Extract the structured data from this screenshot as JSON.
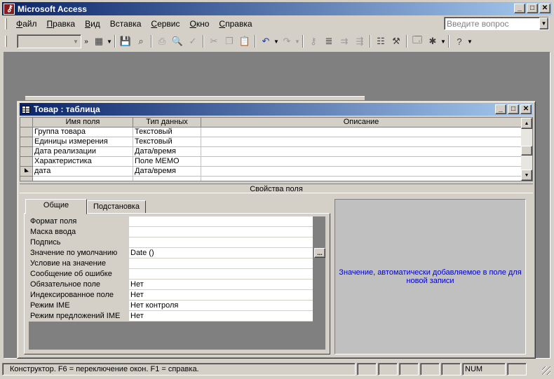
{
  "app": {
    "title": "Microsoft Access",
    "minimize": "_",
    "maximize": "□",
    "close": "✕"
  },
  "menu": {
    "items": [
      {
        "label": "Файл",
        "accel": "Ф",
        "rest": "айл"
      },
      {
        "label": "Правка",
        "accel": "П",
        "rest": "равка"
      },
      {
        "label": "Вид",
        "accel": "В",
        "rest": "ид"
      },
      {
        "label": "Вставка",
        "accel": "",
        "rest": "Вставка"
      },
      {
        "label": "Сервис",
        "accel": "С",
        "rest": "ервис"
      },
      {
        "label": "Окно",
        "accel": "О",
        "rest": "кно"
      },
      {
        "label": "Справка",
        "accel": "С",
        "rest": "правка"
      }
    ],
    "help_placeholder": "Введите вопрос"
  },
  "toolbar": {
    "icons": [
      "view-icon",
      "save-icon",
      "search-icon",
      "print-icon",
      "print-preview-icon",
      "spelling-icon",
      "cut-icon",
      "copy-icon",
      "paste-icon",
      "undo-icon",
      "redo-icon",
      "primary-key-icon",
      "indexes-icon",
      "insert-rows-icon",
      "delete-rows-icon",
      "properties-icon",
      "build-icon",
      "database-window-icon",
      "new-object-icon",
      "help-icon"
    ]
  },
  "window": {
    "title": "Товар : таблица"
  },
  "grid": {
    "columns": [
      "Имя поля",
      "Тип данных",
      "Описание"
    ],
    "rows": [
      {
        "name": "Группа товара",
        "type": "Текстовый",
        "desc": ""
      },
      {
        "name": "Единицы измерения",
        "type": "Текстовый",
        "desc": ""
      },
      {
        "name": "Дата реализации",
        "type": "Дата/время",
        "desc": ""
      },
      {
        "name": "Характеристика",
        "type": "Поле MEMO",
        "desc": ""
      },
      {
        "name": "дата",
        "type": "Дата/время",
        "desc": "",
        "current": true
      }
    ]
  },
  "properties": {
    "section_label": "Свойства поля",
    "tabs": [
      "Общие",
      "Подстановка"
    ],
    "active_tab": "Общие",
    "rows": [
      {
        "label": "Формат поля",
        "value": ""
      },
      {
        "label": "Маска ввода",
        "value": ""
      },
      {
        "label": "Подпись",
        "value": ""
      },
      {
        "label": "Значение по умолчанию",
        "value": "Date ()",
        "builder": "..."
      },
      {
        "label": "Условие на значение",
        "value": ""
      },
      {
        "label": "Сообщение об ошибке",
        "value": ""
      },
      {
        "label": "Обязательное поле",
        "value": "Нет"
      },
      {
        "label": "Индексированное поле",
        "value": "Нет"
      },
      {
        "label": "Режим IME",
        "value": "Нет контроля"
      },
      {
        "label": "Режим предложений IME",
        "value": "Нет"
      }
    ],
    "help_text": "Значение, автоматически добавляемое в поле для новой записи"
  },
  "status": {
    "text": "Конструктор.  F6 = переключение окон.  F1 = справка.",
    "num": "NUM"
  }
}
